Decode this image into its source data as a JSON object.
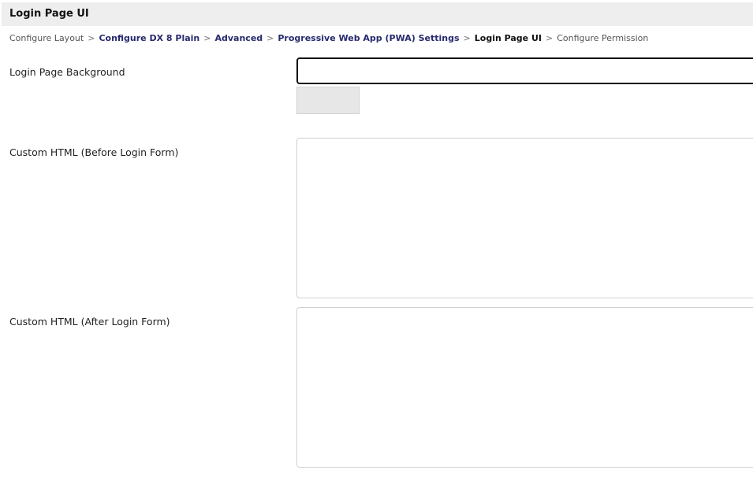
{
  "header": {
    "title": "Login Page UI"
  },
  "breadcrumb": [
    {
      "label": "Configure Layout",
      "style": "plain"
    },
    {
      "label": "Configure DX 8 Plain",
      "style": "link"
    },
    {
      "label": "Advanced",
      "style": "link"
    },
    {
      "label": "Progressive Web App (PWA) Settings",
      "style": "link"
    },
    {
      "label": "Login Page UI",
      "style": "current"
    },
    {
      "label": "Configure Permission",
      "style": "plain"
    }
  ],
  "breadcrumb_separator": ">",
  "form": {
    "background_label": "Login Page Background",
    "background_value": "",
    "before_label": "Custom HTML (Before Login Form)",
    "before_value": "",
    "after_label": "Custom HTML (After Login Form)",
    "after_value": ""
  }
}
